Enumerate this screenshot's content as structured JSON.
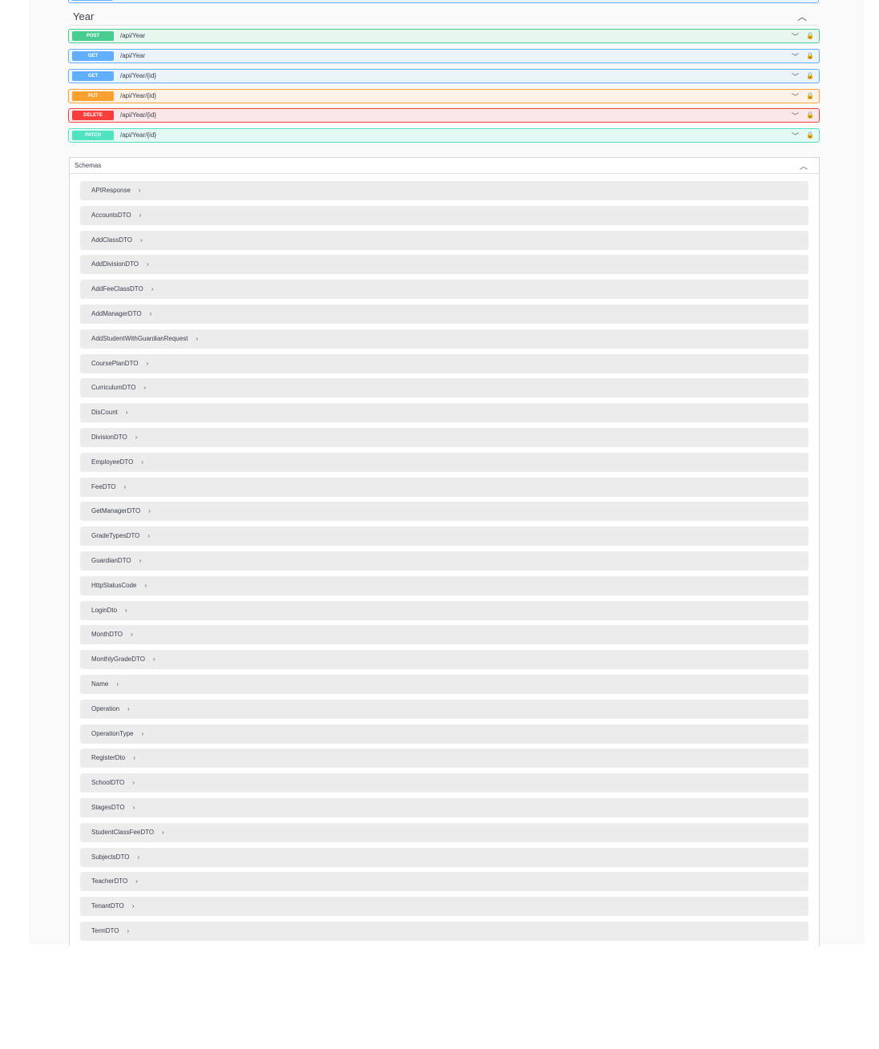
{
  "tag_section": {
    "title": "Year",
    "operations": [
      {
        "method": "POST",
        "kind": "post",
        "path": "/api/Year"
      },
      {
        "method": "GET",
        "kind": "get",
        "path": "/api/Year"
      },
      {
        "method": "GET",
        "kind": "get",
        "path": "/api/Year/{id}"
      },
      {
        "method": "PUT",
        "kind": "put",
        "path": "/api/Year/{id}"
      },
      {
        "method": "DELETE",
        "kind": "delete",
        "path": "/api/Year/{id}"
      },
      {
        "method": "PATCH",
        "kind": "patch",
        "path": "/api/Year/{id}"
      }
    ]
  },
  "schemas": {
    "title": "Schemas",
    "models": [
      "APIResponse",
      "AccountsDTO",
      "AddClassDTO",
      "AddDivisionDTO",
      "AddFeeClassDTO",
      "AddManagerDTO",
      "AddStudentWithGuardianRequest",
      "CoursePlanDTO",
      "CurriculumDTO",
      "DisCount",
      "DivisionDTO",
      "EmployeeDTO",
      "FeeDTO",
      "GetManagerDTO",
      "GradeTypesDTO",
      "GuardianDTO",
      "HttpStatusCode",
      "LoginDto",
      "MonthDTO",
      "MonthlyGradeDTO",
      "Name",
      "Operation",
      "OperationType",
      "RegisterDto",
      "SchoolDTO",
      "StagesDTO",
      "StudentClassFeeDTO",
      "SubjectsDTO",
      "TeacherDTO",
      "TenantDTO",
      "TermDTO"
    ]
  },
  "icons": {
    "expand": "chevron-down-icon",
    "collapse": "chevron-up-icon",
    "lock": "lock-icon",
    "model_arrow": "chevron-right-icon"
  },
  "colors": {
    "post": "#49cc90",
    "get": "#61affe",
    "put": "#fca130",
    "delete": "#f93e3e",
    "patch": "#50e3c2"
  }
}
